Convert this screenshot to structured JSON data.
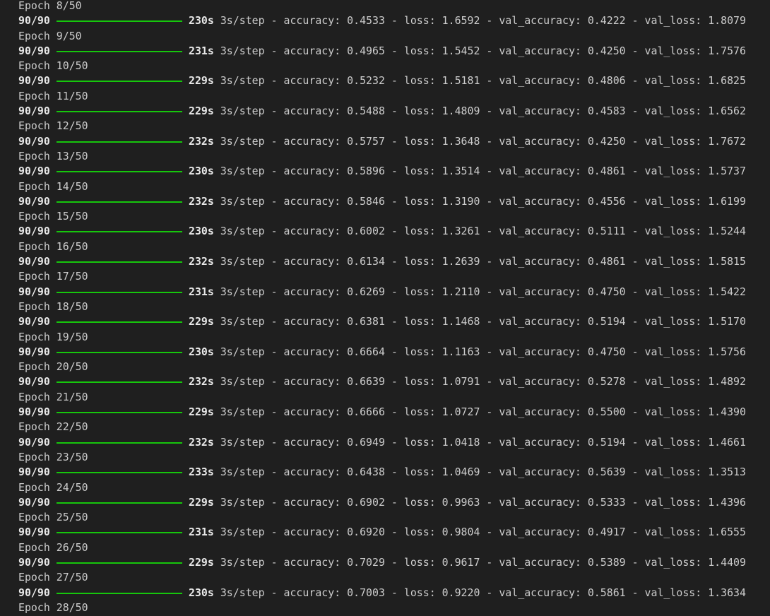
{
  "colors": {
    "background": "#1f1f1f",
    "text": "#cccccc",
    "progress_bar": "#16c60c"
  },
  "log": {
    "first_epoch": "Epoch 8/50",
    "epochs": [
      {
        "steps": "90/90",
        "duration": "230s",
        "rate": "3s/step",
        "accuracy": "0.4533",
        "loss": "1.6592",
        "val_accuracy": "0.4222",
        "val_loss": "1.8079",
        "next_epoch": "Epoch 9/50"
      },
      {
        "steps": "90/90",
        "duration": "231s",
        "rate": "3s/step",
        "accuracy": "0.4965",
        "loss": "1.5452",
        "val_accuracy": "0.4250",
        "val_loss": "1.7576",
        "next_epoch": "Epoch 10/50"
      },
      {
        "steps": "90/90",
        "duration": "229s",
        "rate": "3s/step",
        "accuracy": "0.5232",
        "loss": "1.5181",
        "val_accuracy": "0.4806",
        "val_loss": "1.6825",
        "next_epoch": "Epoch 11/50"
      },
      {
        "steps": "90/90",
        "duration": "229s",
        "rate": "3s/step",
        "accuracy": "0.5488",
        "loss": "1.4809",
        "val_accuracy": "0.4583",
        "val_loss": "1.6562",
        "next_epoch": "Epoch 12/50"
      },
      {
        "steps": "90/90",
        "duration": "232s",
        "rate": "3s/step",
        "accuracy": "0.5757",
        "loss": "1.3648",
        "val_accuracy": "0.4250",
        "val_loss": "1.7672",
        "next_epoch": "Epoch 13/50"
      },
      {
        "steps": "90/90",
        "duration": "230s",
        "rate": "3s/step",
        "accuracy": "0.5896",
        "loss": "1.3514",
        "val_accuracy": "0.4861",
        "val_loss": "1.5737",
        "next_epoch": "Epoch 14/50"
      },
      {
        "steps": "90/90",
        "duration": "232s",
        "rate": "3s/step",
        "accuracy": "0.5846",
        "loss": "1.3190",
        "val_accuracy": "0.4556",
        "val_loss": "1.6199",
        "next_epoch": "Epoch 15/50"
      },
      {
        "steps": "90/90",
        "duration": "230s",
        "rate": "3s/step",
        "accuracy": "0.6002",
        "loss": "1.3261",
        "val_accuracy": "0.5111",
        "val_loss": "1.5244",
        "next_epoch": "Epoch 16/50"
      },
      {
        "steps": "90/90",
        "duration": "232s",
        "rate": "3s/step",
        "accuracy": "0.6134",
        "loss": "1.2639",
        "val_accuracy": "0.4861",
        "val_loss": "1.5815",
        "next_epoch": "Epoch 17/50"
      },
      {
        "steps": "90/90",
        "duration": "231s",
        "rate": "3s/step",
        "accuracy": "0.6269",
        "loss": "1.2110",
        "val_accuracy": "0.4750",
        "val_loss": "1.5422",
        "next_epoch": "Epoch 18/50"
      },
      {
        "steps": "90/90",
        "duration": "229s",
        "rate": "3s/step",
        "accuracy": "0.6381",
        "loss": "1.1468",
        "val_accuracy": "0.5194",
        "val_loss": "1.5170",
        "next_epoch": "Epoch 19/50"
      },
      {
        "steps": "90/90",
        "duration": "230s",
        "rate": "3s/step",
        "accuracy": "0.6664",
        "loss": "1.1163",
        "val_accuracy": "0.4750",
        "val_loss": "1.5756",
        "next_epoch": "Epoch 20/50"
      },
      {
        "steps": "90/90",
        "duration": "232s",
        "rate": "3s/step",
        "accuracy": "0.6639",
        "loss": "1.0791",
        "val_accuracy": "0.5278",
        "val_loss": "1.4892",
        "next_epoch": "Epoch 21/50"
      },
      {
        "steps": "90/90",
        "duration": "229s",
        "rate": "3s/step",
        "accuracy": "0.6666",
        "loss": "1.0727",
        "val_accuracy": "0.5500",
        "val_loss": "1.4390",
        "next_epoch": "Epoch 22/50"
      },
      {
        "steps": "90/90",
        "duration": "232s",
        "rate": "3s/step",
        "accuracy": "0.6949",
        "loss": "1.0418",
        "val_accuracy": "0.5194",
        "val_loss": "1.4661",
        "next_epoch": "Epoch 23/50"
      },
      {
        "steps": "90/90",
        "duration": "233s",
        "rate": "3s/step",
        "accuracy": "0.6438",
        "loss": "1.0469",
        "val_accuracy": "0.5639",
        "val_loss": "1.3513",
        "next_epoch": "Epoch 24/50"
      },
      {
        "steps": "90/90",
        "duration": "229s",
        "rate": "3s/step",
        "accuracy": "0.6902",
        "loss": "0.9963",
        "val_accuracy": "0.5333",
        "val_loss": "1.4396",
        "next_epoch": "Epoch 25/50"
      },
      {
        "steps": "90/90",
        "duration": "231s",
        "rate": "3s/step",
        "accuracy": "0.6920",
        "loss": "0.9804",
        "val_accuracy": "0.4917",
        "val_loss": "1.6555",
        "next_epoch": "Epoch 26/50"
      },
      {
        "steps": "90/90",
        "duration": "229s",
        "rate": "3s/step",
        "accuracy": "0.7029",
        "loss": "0.9617",
        "val_accuracy": "0.5389",
        "val_loss": "1.4409",
        "next_epoch": "Epoch 27/50"
      },
      {
        "steps": "90/90",
        "duration": "230s",
        "rate": "3s/step",
        "accuracy": "0.7003",
        "loss": "0.9220",
        "val_accuracy": "0.5861",
        "val_loss": "1.3634",
        "next_epoch": "Epoch 28/50"
      }
    ]
  }
}
